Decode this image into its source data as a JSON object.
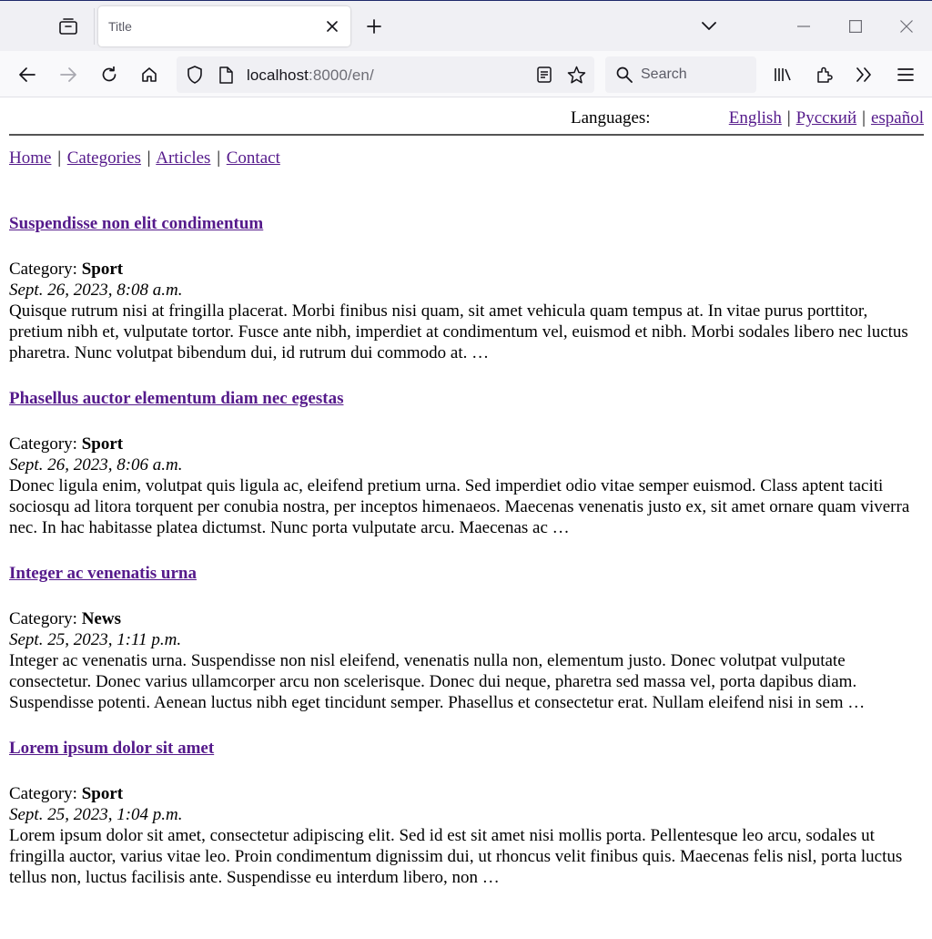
{
  "browser": {
    "tab_title": "Title",
    "url_host": "localhost",
    "url_path": ":8000/en/",
    "search_placeholder": "Search"
  },
  "icons": {
    "tab_overview": "tab-overview-icon",
    "close": "close-icon",
    "plus": "plus-icon",
    "chevron": "chevron-down-icon",
    "back": "back-arrow-icon",
    "forward": "forward-arrow-icon",
    "reload": "reload-icon",
    "home": "home-icon",
    "shield": "shield-icon",
    "page": "page-icon",
    "reader": "reader-view-icon",
    "star": "star-icon",
    "library": "library-icon",
    "extensions": "puzzle-icon",
    "overflow": "double-chevron-icon",
    "menu": "hamburger-menu-icon"
  },
  "colors": {
    "link": "#551a8b",
    "text": "#000000"
  },
  "languages": {
    "label": "Languages:",
    "items": [
      "English",
      "Русский",
      "español"
    ]
  },
  "nav": {
    "items": [
      "Home",
      "Categories",
      "Articles",
      "Contact"
    ]
  },
  "articles": [
    {
      "title": "Suspendisse non elit condimentum",
      "category_label": "Category:",
      "category": "Sport",
      "date": "Sept. 26, 2023, 8:08 a.m.",
      "excerpt": "Quisque rutrum nisi at fringilla placerat. Morbi finibus nisi quam, sit amet vehicula quam tempus at. In vitae purus porttitor, pretium nibh et, vulputate tortor. Fusce ante nibh, imperdiet at condimentum vel, euismod et nibh. Morbi sodales libero nec luctus pharetra. Nunc volutpat bibendum dui, id rutrum dui commodo at. …"
    },
    {
      "title": "Phasellus auctor elementum diam nec egestas",
      "category_label": "Category:",
      "category": "Sport",
      "date": "Sept. 26, 2023, 8:06 a.m.",
      "excerpt": "Donec ligula enim, volutpat quis ligula ac, eleifend pretium urna. Sed imperdiet odio vitae semper euismod. Class aptent taciti sociosqu ad litora torquent per conubia nostra, per inceptos himenaeos. Maecenas venenatis justo ex, sit amet ornare quam viverra nec. In hac habitasse platea dictumst. Nunc porta vulputate arcu. Maecenas ac …"
    },
    {
      "title": "Integer ac venenatis urna",
      "category_label": "Category:",
      "category": "News",
      "date": "Sept. 25, 2023, 1:11 p.m.",
      "excerpt": "Integer ac venenatis urna. Suspendisse non nisl eleifend, venenatis nulla non, elementum justo. Donec volutpat vulputate consectetur. Donec varius ullamcorper arcu non scelerisque. Donec dui neque, pharetra sed massa vel, porta dapibus diam. Suspendisse potenti. Aenean luctus nibh eget tincidunt semper. Phasellus et consectetur erat. Nullam eleifend nisi in sem …"
    },
    {
      "title": "Lorem ipsum dolor sit amet",
      "category_label": "Category:",
      "category": "Sport",
      "date": "Sept. 25, 2023, 1:04 p.m.",
      "excerpt": "Lorem ipsum dolor sit amet, consectetur adipiscing elit. Sed id est sit amet nisi mollis porta. Pellentesque leo arcu, sodales ut fringilla auctor, varius vitae leo. Proin condimentum dignissim dui, ut rhoncus velit finibus quis. Maecenas felis nisl, porta luctus tellus non, luctus facilisis ante. Suspendisse eu interdum libero, non …"
    }
  ]
}
